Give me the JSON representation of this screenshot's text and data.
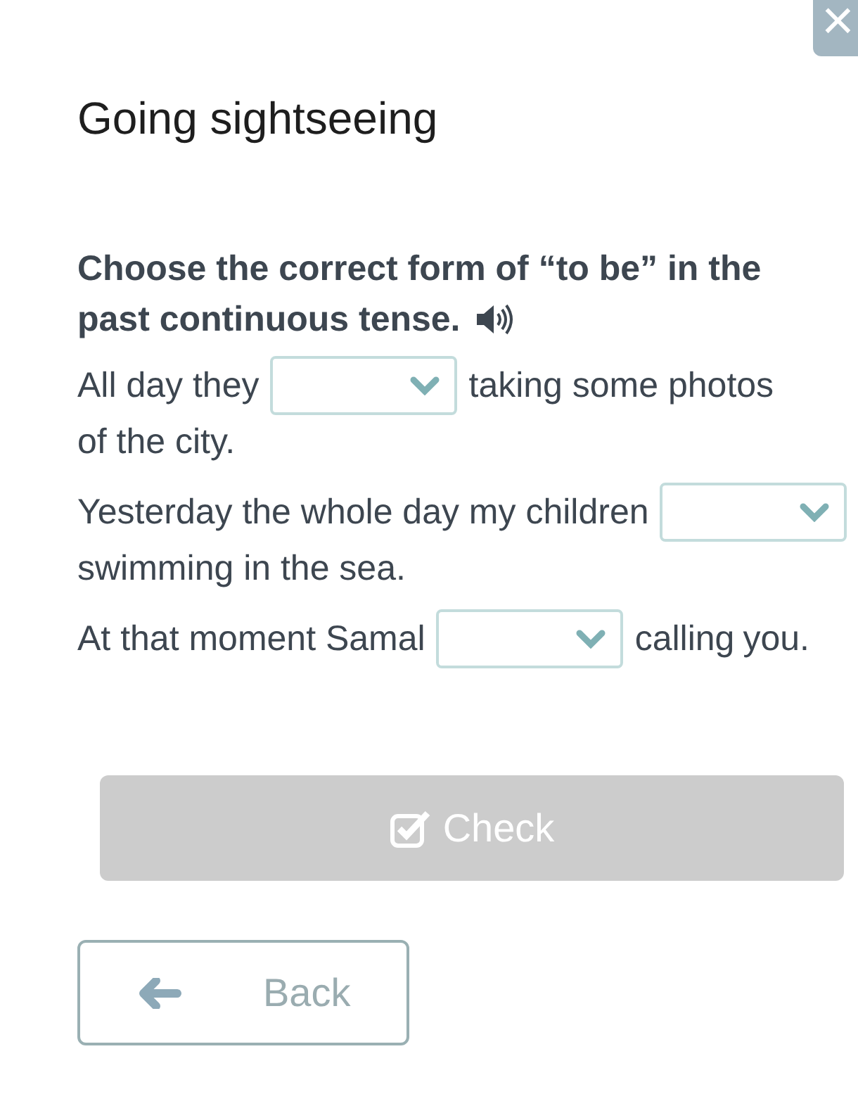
{
  "close_button": {
    "icon": "×"
  },
  "title": "Going sightseeing",
  "instruction": [
    "Choose the correct form of “to be” in the",
    "past continuous tense."
  ],
  "sentences": [
    {
      "parts": [
        {
          "kind": "text",
          "text": "All day they"
        },
        {
          "kind": "dropdown"
        },
        {
          "kind": "text",
          "text": "taking some photos"
        },
        {
          "kind": "text",
          "text": "of the city."
        }
      ]
    },
    {
      "parts": [
        {
          "kind": "text",
          "text": "Yesterday the whole day my children"
        },
        {
          "kind": "dropdown"
        },
        {
          "kind": "text",
          "text": "swimming in the sea."
        }
      ]
    },
    {
      "parts": [
        {
          "kind": "text",
          "text": "At that moment Samal"
        },
        {
          "kind": "dropdown"
        },
        {
          "kind": "text",
          "text": "calling"
        },
        {
          "kind": "text",
          "text": "you."
        }
      ]
    }
  ],
  "check_button": {
    "label": "Check",
    "disabled": true
  },
  "back_button": {
    "label": "Back"
  }
}
